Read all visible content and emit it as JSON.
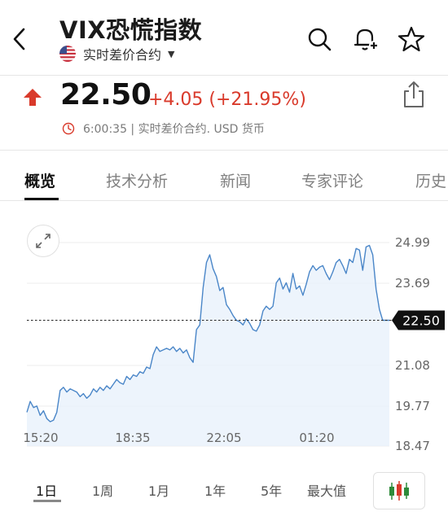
{
  "header": {
    "title": "VIX恐慌指数",
    "subtitle": "实时差价合约",
    "icons": [
      "back-icon",
      "search-icon",
      "add-alert-icon",
      "star-icon"
    ]
  },
  "quote": {
    "price": "22.50",
    "change": "+4.05 (+21.95%)",
    "meta": "6:00:35 | 实时差价合约.  USD 货币",
    "direction": "up",
    "up_color": "#d93a2b"
  },
  "tabs": [
    {
      "label": "概览",
      "active": true
    },
    {
      "label": "技术分析",
      "active": false
    },
    {
      "label": "新闻",
      "active": false
    },
    {
      "label": "专家评论",
      "active": false
    },
    {
      "label": "历史",
      "active": false
    }
  ],
  "ranges": [
    {
      "label": "1日",
      "active": true
    },
    {
      "label": "1周",
      "active": false
    },
    {
      "label": "1月",
      "active": false
    },
    {
      "label": "1年",
      "active": false
    },
    {
      "label": "5年",
      "active": false
    },
    {
      "label": "最大值",
      "active": false
    }
  ],
  "chart_data": {
    "type": "area",
    "x_ticks": [
      "15:20",
      "18:35",
      "22:05",
      "01:20"
    ],
    "y_ticks": [
      "24.99",
      "23.69",
      "22.39",
      "21.08",
      "19.77",
      "18.47"
    ],
    "ylim": [
      18.47,
      25.3
    ],
    "current_value": "22.50",
    "line_color": "#4a86c8",
    "series": [
      {
        "values": [
          19.55,
          19.9,
          19.7,
          19.75,
          19.45,
          19.6,
          19.35,
          19.25,
          19.3,
          19.55,
          20.25,
          20.35,
          20.2,
          20.3,
          20.25,
          20.2,
          20.05,
          20.15,
          20.0,
          20.1,
          20.3,
          20.2,
          20.35,
          20.25,
          20.4,
          20.3,
          20.45,
          20.6,
          20.5,
          20.45,
          20.7,
          20.6,
          20.75,
          20.7,
          20.85,
          20.8,
          21.0,
          20.95,
          21.4,
          21.65,
          21.5,
          21.55,
          21.6,
          21.55,
          21.65,
          21.5,
          21.6,
          21.45,
          21.55,
          21.3,
          21.15,
          22.2,
          22.35,
          23.55,
          24.35,
          24.6,
          24.15,
          23.9,
          23.45,
          23.55,
          23.0,
          22.85,
          22.65,
          22.5,
          22.45,
          22.35,
          22.55,
          22.4,
          22.2,
          22.15,
          22.35,
          22.8,
          22.95,
          22.85,
          22.95,
          23.7,
          23.85,
          23.5,
          23.7,
          23.4,
          24.0,
          23.5,
          23.6,
          23.3,
          23.65,
          24.05,
          24.25,
          24.1,
          24.2,
          24.25,
          24.0,
          23.8,
          24.05,
          24.35,
          24.45,
          24.25,
          24.0,
          24.45,
          24.35,
          24.8,
          24.75,
          24.1,
          24.85,
          24.9,
          24.6,
          23.5,
          22.85,
          22.5,
          22.5,
          22.5
        ]
      }
    ]
  }
}
